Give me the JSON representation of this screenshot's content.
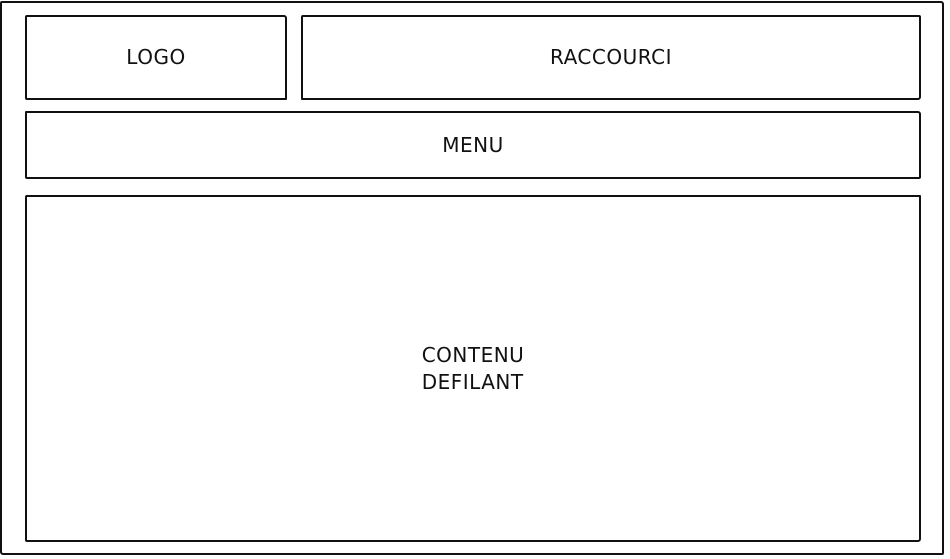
{
  "wireframe": {
    "logo": {
      "label": "LOGO"
    },
    "shortcuts": {
      "label": "RACCOURCI"
    },
    "menu": {
      "label": "MENU"
    },
    "content": {
      "lines": [
        "CONTENU",
        "DEFILANT"
      ]
    }
  },
  "colors": {
    "stroke": "#111111",
    "background": "#ffffff"
  }
}
